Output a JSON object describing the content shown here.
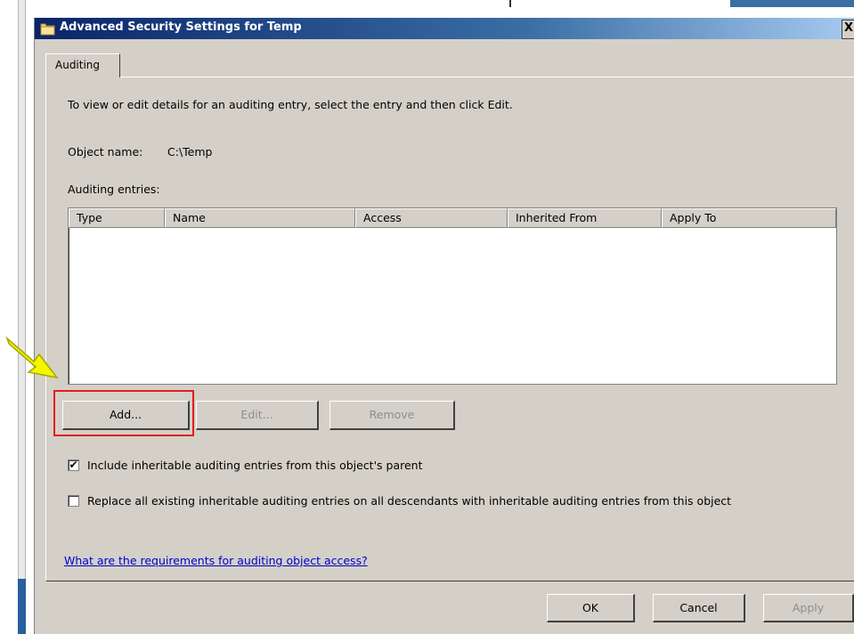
{
  "window": {
    "title": "Advanced Security Settings for Temp",
    "close_glyph": "X"
  },
  "tab": {
    "label": "Auditing"
  },
  "instructions": "To view or edit details for an auditing entry, select the entry and then click Edit.",
  "object": {
    "label": "Object name:",
    "value": "C:\\Temp"
  },
  "entries": {
    "label": "Auditing entries:",
    "columns": [
      "Type",
      "Name",
      "Access",
      "Inherited From",
      "Apply To"
    ],
    "rows": []
  },
  "buttons": {
    "add": "Add...",
    "edit": "Edit...",
    "remove": "Remove",
    "ok": "OK",
    "cancel": "Cancel",
    "apply": "Apply"
  },
  "checkboxes": {
    "include": {
      "label": "Include inheritable auditing entries from this object's parent",
      "checked": true,
      "mark": "✔"
    },
    "replace": {
      "label": "Replace all existing inheritable auditing entries on all descendants with inheritable auditing entries from this object",
      "checked": false
    }
  },
  "help_link": "What are the requirements for auditing object access?",
  "colors": {
    "highlight_box": "#e01e1e",
    "arrow": "#f5f500",
    "link": "#0000cc"
  }
}
